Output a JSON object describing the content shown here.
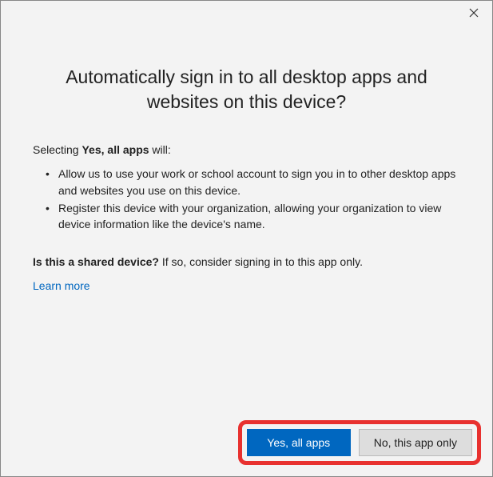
{
  "dialog": {
    "heading": "Automatically sign in to all desktop apps and websites on this device?",
    "intro_prefix": "Selecting ",
    "intro_bold": "Yes, all apps",
    "intro_suffix": " will:",
    "bullets": [
      "Allow us to use your work or school account to sign you in to other desktop apps and websites you use on this device.",
      "Register this device with your organization, allowing your organization to view device information like the device's name."
    ],
    "shared_bold": "Is this a shared device?",
    "shared_rest": " If so, consider signing in to this app only.",
    "learn_more": "Learn more",
    "buttons": {
      "yes": "Yes, all apps",
      "no": "No, this app only"
    }
  }
}
